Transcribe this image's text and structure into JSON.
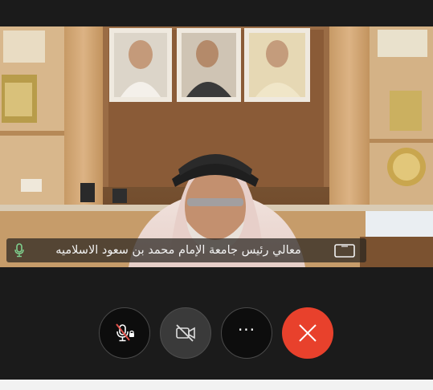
{
  "meeting": {
    "participant_caption": "معالي رئيس جامعة الإمام محمد بن سعود الاسلاميه"
  },
  "controls": {
    "more_label": "···"
  },
  "icons": {
    "caption_mic": "microphone-icon",
    "caption_screen": "screen-share-icon",
    "mute": "muted-microphone-locked-icon",
    "video": "video-off-icon",
    "more": "more-options-icon",
    "leave": "close-icon"
  },
  "colors": {
    "leave_button": "#e8412c",
    "mic_indicator": "#7fd08e",
    "muted_slash": "#e0504a"
  }
}
